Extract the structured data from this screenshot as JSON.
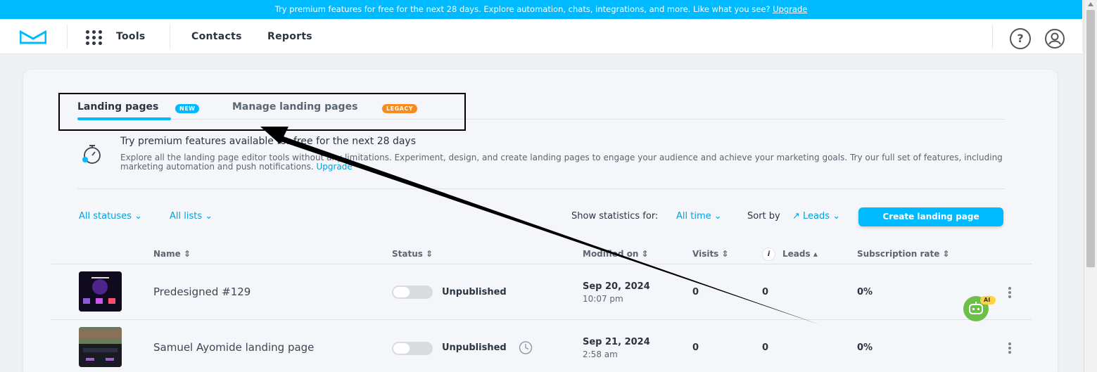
{
  "banner": {
    "text": "Try premium features for free for the next 28 days. Explore automation, chats, integrations, and more. Like what you see?",
    "link": "Upgrade"
  },
  "topbar": {
    "tools": "Tools",
    "contacts": "Contacts",
    "reports": "Reports",
    "help_glyph": "?"
  },
  "tabs": [
    {
      "label": "Landing pages",
      "badge": "NEW",
      "badge_color": "#00baff"
    },
    {
      "label": "Manage landing pages",
      "badge": "LEGACY",
      "badge_color": "#f68b1f"
    }
  ],
  "promo": {
    "title": "Try premium features available for free for the next 28 days",
    "text": "Explore all the landing page editor tools without any limitations. Experiment, design, and create landing pages to engage your audience and achieve your marketing goals. Try our full set of features, including marketing automation and push notifications.",
    "link": "Upgrade"
  },
  "filters": {
    "statuses": "All statuses",
    "lists": "All lists",
    "stats_label": "Show statistics for:",
    "stats_value": "All time",
    "sort_label": "Sort by",
    "sort_value": "Leads",
    "create_button": "Create landing page"
  },
  "table": {
    "headers": {
      "name": "Name",
      "status": "Status",
      "modified": "Modified on",
      "visits": "Visits",
      "info_glyph": "i",
      "leads": "Leads",
      "subscription": "Subscription rate"
    },
    "rows": [
      {
        "name": "Predesigned #129",
        "status": "Unpublished",
        "date": "Sep 20, 2024",
        "time": "10:07 pm",
        "visits": "0",
        "leads": "0",
        "rate": "0%"
      },
      {
        "name": "Samuel Ayomide landing page",
        "status": "Unpublished",
        "date": "Sep 21, 2024",
        "time": "2:58 am",
        "visits": "0",
        "leads": "0",
        "rate": "0%"
      }
    ]
  },
  "ai_badge": "AI",
  "colors": {
    "accent": "#00baff",
    "link": "#00a2e0",
    "legacy": "#f68b1f",
    "ai_green": "#6cc04a"
  },
  "icons": [
    "envelope-logo-icon",
    "grid-icon",
    "help-icon",
    "user-icon",
    "stopwatch-icon",
    "sort-icon",
    "chevron-down-icon",
    "trend-up-icon",
    "clock-icon",
    "kebab-icon",
    "ai-robot-icon"
  ]
}
